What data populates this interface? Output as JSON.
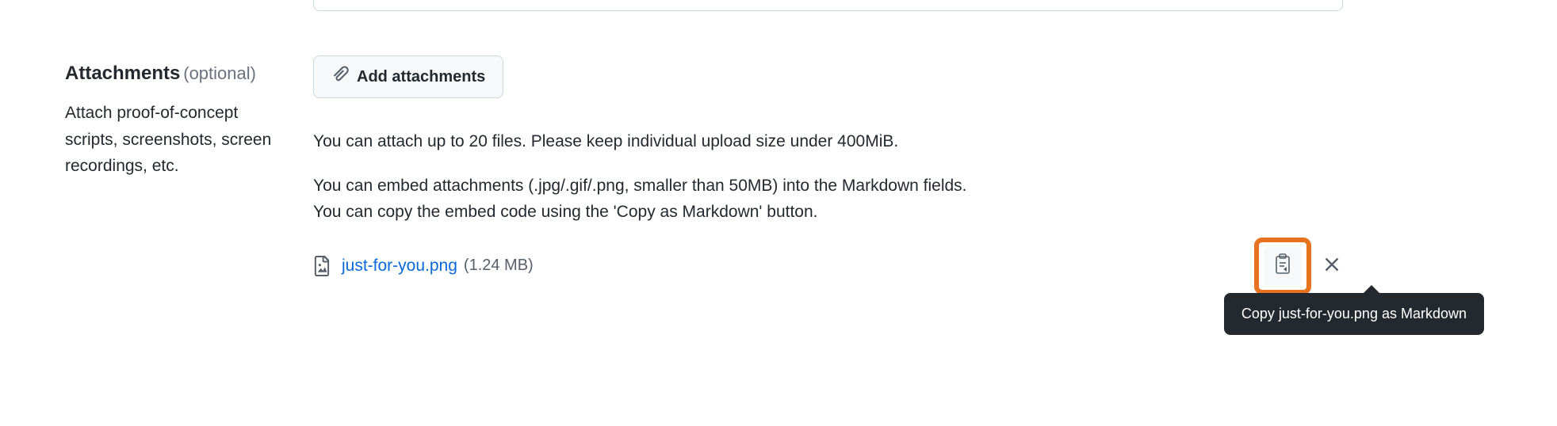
{
  "section": {
    "heading": "Attachments",
    "optional_label": "(optional)",
    "description": "Attach proof-of-concept scripts, screenshots, screen recordings, etc."
  },
  "add_button": {
    "label": "Add attachments"
  },
  "help": {
    "text1": "You can attach up to 20 files. Please keep individual upload size under 400MiB.",
    "text2": "You can embed attachments (.jpg/.gif/.png, smaller than 50MB) into the Markdown fields. You can copy the embed code using the 'Copy as Markdown' button."
  },
  "file": {
    "name": "just-for-you.png",
    "size": "(1.24 MB)"
  },
  "tooltip": {
    "text": "Copy just-for-you.png as Markdown"
  }
}
